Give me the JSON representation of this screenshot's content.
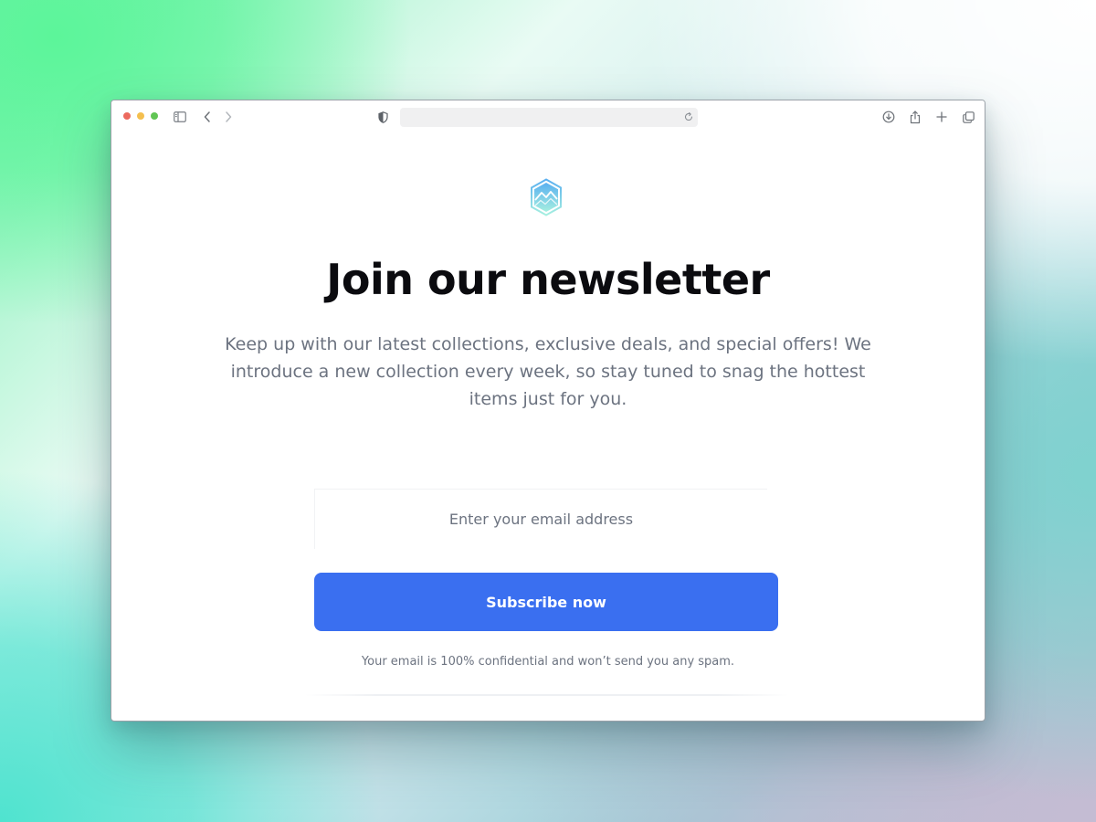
{
  "browser": {
    "address_text": ""
  },
  "newsletter": {
    "title": "Join our newsletter",
    "description": "Keep up with our latest collections, exclusive deals, and special offers! We introduce a new collection every week, so stay tuned to snag the hottest items just for you.",
    "email_placeholder": "Enter your email address",
    "email_value": "",
    "subscribe_label": "Subscribe now",
    "disclaimer": "Your email is 100% confidential and won’t send you any spam."
  },
  "colors": {
    "accent": "#3a6ff0",
    "title": "#0b0b0f",
    "muted_text": "#6c7380",
    "logo_top": "#5ab0f0",
    "logo_bottom": "#a6efe0"
  },
  "icons": {
    "traffic_lights": [
      "close",
      "minimize",
      "zoom"
    ],
    "toolbar_left": [
      "sidebar-icon",
      "back-icon",
      "forward-icon"
    ],
    "address_left": "shield-icon",
    "address_right": "reload-icon",
    "toolbar_right": [
      "download-icon",
      "share-icon",
      "new-tab-icon",
      "tabs-overview-icon"
    ],
    "brand": "mountain-hexagon-logo"
  }
}
